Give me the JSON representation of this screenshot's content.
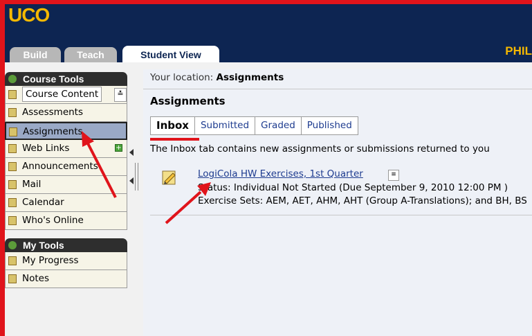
{
  "header": {
    "logo": "UCO",
    "user_name": "PHIL",
    "tabs": [
      {
        "label": "Build"
      },
      {
        "label": "Teach"
      },
      {
        "label": "Student View"
      }
    ]
  },
  "sidebar": {
    "course_tools": {
      "title": "Course Tools",
      "items": [
        {
          "label": "Course Content"
        },
        {
          "label": "Assessments"
        },
        {
          "label": "Assignments"
        },
        {
          "label": "Web Links"
        },
        {
          "label": "Announcements"
        },
        {
          "label": "Mail"
        },
        {
          "label": "Calendar"
        },
        {
          "label": "Who's Online"
        }
      ]
    },
    "my_tools": {
      "title": "My Tools",
      "items": [
        {
          "label": "My Progress"
        },
        {
          "label": "Notes"
        }
      ]
    }
  },
  "main": {
    "location_prefix": "Your location:",
    "location_current": "Assignments",
    "title": "Assignments",
    "tabs": [
      {
        "label": "Inbox"
      },
      {
        "label": "Submitted"
      },
      {
        "label": "Graded"
      },
      {
        "label": "Published"
      }
    ],
    "info": "The Inbox tab contains new assignments or submissions returned to you",
    "item": {
      "title": "LogiCola HW Exercises, 1st Quarter",
      "status": "Status: Individual Not Started (Due September 9, 2010 12:00 PM )",
      "sets": "Exercise Sets: AEM, AET, AHM, AHT (Group A-Translations); and BH, BS"
    }
  },
  "colors": {
    "header_bg": "#0d2552",
    "brand_gold": "#f5b800",
    "annotation_red": "#e0141b",
    "active_item_bg": "#9aa9c6"
  }
}
